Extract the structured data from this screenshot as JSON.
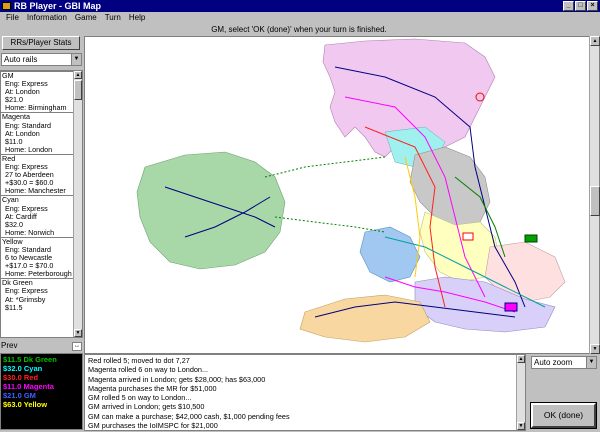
{
  "window": {
    "title": "RB Player - GBI Map",
    "minimize": "_",
    "maximize": "□",
    "close": "×"
  },
  "menu": [
    "File",
    "Information",
    "Game",
    "Turn",
    "Help"
  ],
  "status": "GM, select 'OK (done)' when your turn is finished.",
  "left": {
    "stats_button": "RRs/Player Stats",
    "rails_select": "Auto rails",
    "players": [
      {
        "name": "GM",
        "lines": [
          "Eng: Express",
          "At: London",
          "$21.0",
          "Home: Birmingham"
        ]
      },
      {
        "name": "Magenta",
        "lines": [
          "Eng: Standard",
          "At: London",
          "$11.0",
          "Home: London"
        ]
      },
      {
        "name": "Red",
        "lines": [
          "Eng: Express",
          "27 to Aberdeen",
          "+$30.0 = $60.0",
          "Home: Manchester"
        ]
      },
      {
        "name": "Cyan",
        "lines": [
          "Eng: Express",
          "At: Cardiff",
          "$32.0",
          "Home: Norwich"
        ]
      },
      {
        "name": "Yellow",
        "lines": [
          "Eng: Standard",
          "6 to Newcastle",
          "+$17.0 = $70.0",
          "Home: Peterborough"
        ]
      },
      {
        "name": "Dk Green",
        "lines": [
          "Eng: Express",
          "At: *Grimsby",
          "$11.5"
        ]
      }
    ],
    "prev_label": "Prev"
  },
  "cash": [
    {
      "text": "$11.5 Dk Green",
      "color": "#00c000"
    },
    {
      "text": "$32.0 Cyan",
      "color": "#00ffff"
    },
    {
      "text": "$30.0 Red",
      "color": "#ff2020"
    },
    {
      "text": "$11.0 Magenta",
      "color": "#ff00ff"
    },
    {
      "text": "$21.0 GM",
      "color": "#4060ff"
    },
    {
      "text": "$63.0 Yellow",
      "color": "#ffff00"
    }
  ],
  "log": [
    "Red rolled 5; moved to dot 7,27",
    "Magenta rolled 6 on way to London...",
    "Magenta arrived in London; gets $28,000; has $63,000",
    "Magenta purchases the MR for $51,000",
    "GM rolled 5 on way to London...",
    "GM arrived in London; gets $10,500",
    "GM can make a purchase;  $42,000 cash, $1,000 pending fees",
    "GM purchases the IoIMSPC for $21,000"
  ],
  "zoom_select": "Auto zoom",
  "ok_button": "OK (done)",
  "map": {
    "colors": {
      "sea": "#ffffff",
      "ireland": "#a8d8a8",
      "scotland": "#f0c8f0",
      "england_north": "#c8c8c8",
      "wales": "#a0c8f0",
      "midlands": "#ffffc0",
      "southwest": "#f8d8a0",
      "east": "#ffe0e0",
      "south": "#d8d0f8",
      "cyan_region": "#a0f0f0"
    }
  }
}
